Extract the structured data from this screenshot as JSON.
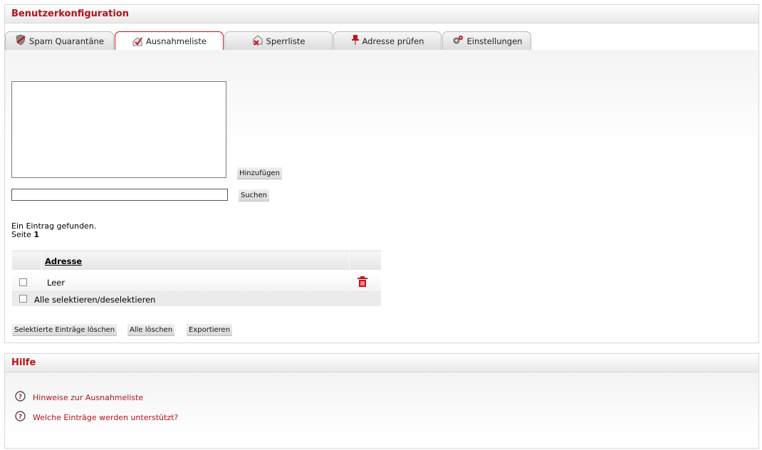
{
  "config": {
    "title": "Benutzerkonfiguration",
    "tabs": [
      {
        "label": "Spam Quarantäne",
        "icon": "shield-icon",
        "active": false
      },
      {
        "label": "Ausnahmeliste",
        "icon": "whitelist-check-icon",
        "active": true
      },
      {
        "label": "Sperrliste",
        "icon": "blacklist-x-icon",
        "active": false
      },
      {
        "label": "Adresse prüfen",
        "icon": "pin-icon",
        "active": false
      },
      {
        "label": "Einstellungen",
        "icon": "gear-icon",
        "active": false
      }
    ],
    "textarea_value": "",
    "add_label": "Hinzufügen",
    "search_value": "",
    "search_label": "Suchen",
    "result_text": "Ein Eintrag gefunden.",
    "page_label": "Seite",
    "page_number": "1",
    "table": {
      "column_address": "Adresse",
      "rows": [
        {
          "address": "Leer",
          "checked": false
        }
      ],
      "select_all_label": "Alle selektieren/deselektieren"
    },
    "buttons": {
      "delete_selected": "Selektierte Einträge löschen",
      "delete_all": "Alle löschen",
      "export": "Exportieren"
    }
  },
  "help": {
    "title": "Hilfe",
    "links": [
      {
        "label": "Hinweise zur Ausnahmeliste",
        "icon": "help-circle-icon"
      },
      {
        "label": "Welche Einträge werden unterstützt?",
        "icon": "help-circle-icon"
      }
    ]
  },
  "colors": {
    "accent": "#b5121b",
    "tab_border_active": "#c9121b"
  }
}
